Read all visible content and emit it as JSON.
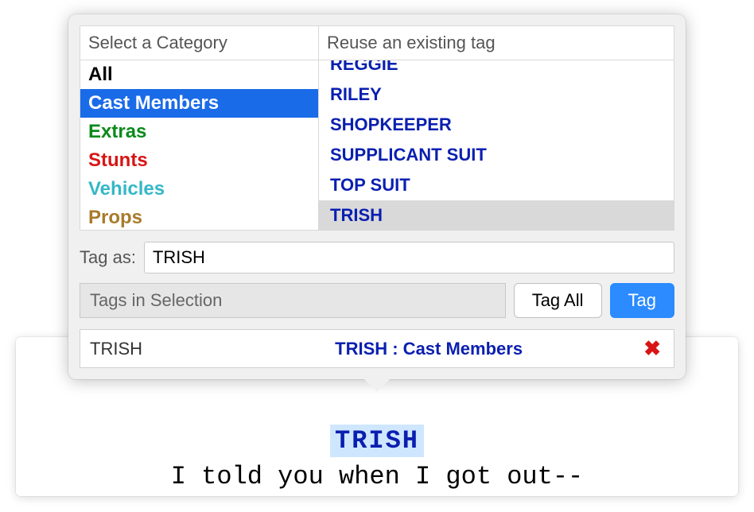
{
  "script": {
    "cue": "TRISH",
    "dialogue": "I told you when I got out--"
  },
  "popup": {
    "category_header": "Select a Category",
    "tag_header": "Reuse an existing tag",
    "categories": [
      {
        "label": "All",
        "color": "#000000",
        "selected": false
      },
      {
        "label": "Cast Members",
        "color": "#ffffff",
        "selected": true
      },
      {
        "label": "Extras",
        "color": "#0a8a1a",
        "selected": false
      },
      {
        "label": "Stunts",
        "color": "#d81515",
        "selected": false
      },
      {
        "label": "Vehicles",
        "color": "#35b7c7",
        "selected": false
      },
      {
        "label": "Props",
        "color": "#a87b2a",
        "selected": false
      }
    ],
    "tags": [
      {
        "label": "REGGIE",
        "selected": false,
        "partial": true
      },
      {
        "label": "RILEY",
        "selected": false
      },
      {
        "label": "SHOPKEEPER",
        "selected": false
      },
      {
        "label": "SUPPLICANT SUIT",
        "selected": false
      },
      {
        "label": "TOP SUIT",
        "selected": false
      },
      {
        "label": "TRISH",
        "selected": true
      }
    ],
    "tag_as_label": "Tag as:",
    "tag_as_value": "TRISH",
    "selection_label": "Tags in Selection",
    "tag_all_btn": "Tag All",
    "tag_btn": "Tag",
    "assigned": {
      "name": "TRISH",
      "full": "TRISH : Cast Members"
    }
  }
}
